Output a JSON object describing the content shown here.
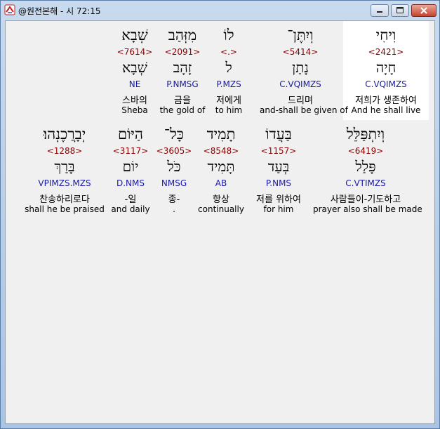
{
  "window": {
    "title": "@원전본해 - 시 72:15"
  },
  "colors": {
    "strong": "#8b0000",
    "morph": "#1a1aa6",
    "highlight": "#ffffff"
  },
  "words": [
    {
      "hebrew": "וִיחִי",
      "strong": "<2421>",
      "lemma": "חָיָה",
      "morph": "C.VQIMZS",
      "korean": "저희가 생존하여",
      "english": "And he shall live",
      "highlighted": true
    },
    {
      "hebrew": "וְיִתֶּן־",
      "strong": "<5414>",
      "lemma": "נָתַן",
      "morph": "C.VQIMZS",
      "korean": "드리며",
      "english": "and-shall be given of",
      "highlighted": false
    },
    {
      "hebrew": "לוֹ",
      "strong": "<.>",
      "lemma": "ל",
      "morph": "P.MZS",
      "korean": "저에게",
      "english": "to him",
      "highlighted": false
    },
    {
      "hebrew": "מִזְּהַב",
      "strong": "<2091>",
      "lemma": "זָהָב",
      "morph": "P.NMSG",
      "korean": "금을",
      "english": "the gold of",
      "highlighted": false
    },
    {
      "hebrew": "שְׁבָא",
      "strong": "<7614>",
      "lemma": "שְׁבָא",
      "morph": "NE",
      "korean": "스바의",
      "english": "Sheba",
      "highlighted": false
    },
    {
      "hebrew": "וְיִתְפַּלֵּל",
      "strong": "<6419>",
      "lemma": "פָּלַל",
      "morph": "C.VTIMZS",
      "korean": "사람들이-기도하고",
      "english": "prayer also shall be made",
      "highlighted": false
    },
    {
      "hebrew": "בַּעֲדוֹ",
      "strong": "<1157>",
      "lemma": "בְּעַד",
      "morph": "P.NMS",
      "korean": "저를 위하여",
      "english": "for him",
      "highlighted": false
    },
    {
      "hebrew": "תָמִיד",
      "strong": "<8548>",
      "lemma": "תָּמִיד",
      "morph": "AB",
      "korean": "항상",
      "english": "continually",
      "highlighted": false
    },
    {
      "hebrew": "כָּל־",
      "strong": "<3605>",
      "lemma": "כֹּל",
      "morph": "NMSG",
      "korean": "종-",
      "english": ".",
      "highlighted": false
    },
    {
      "hebrew": "הַיּוֹם",
      "strong": "<3117>",
      "lemma": "יוֹם",
      "morph": "D.NMS",
      "korean": "-일",
      "english": "and daily",
      "highlighted": false
    },
    {
      "hebrew": "יְבָרֲכֶנְהוּ׃",
      "strong": "<1288>",
      "lemma": "בָּרַךְ",
      "morph": "VPIMZS.MZS",
      "korean": "찬송하리로다",
      "english": "shall he be praised",
      "highlighted": false
    }
  ]
}
